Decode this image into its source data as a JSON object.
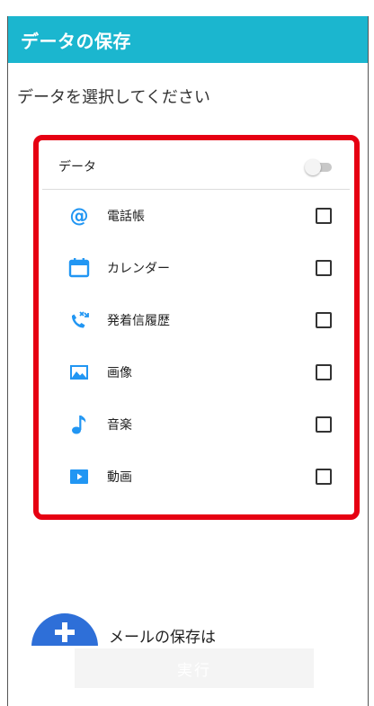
{
  "appbar": {
    "title": "データの保存"
  },
  "prompt": "データを選択してください",
  "card": {
    "header_label": "データ",
    "toggle_on": false,
    "items": [
      {
        "label": "電話帳",
        "icon": "at-sign-icon",
        "checked": false
      },
      {
        "label": "カレンダー",
        "icon": "calendar-icon",
        "checked": false
      },
      {
        "label": "発着信履歴",
        "icon": "call-log-icon",
        "checked": false
      },
      {
        "label": "画像",
        "icon": "image-icon",
        "checked": false
      },
      {
        "label": "音楽",
        "icon": "music-note-icon",
        "checked": false
      },
      {
        "label": "動画",
        "icon": "video-play-icon",
        "checked": false
      }
    ]
  },
  "fab": {
    "label": "メールの保存は"
  },
  "run_button": {
    "label": "実行"
  },
  "colors": {
    "accent": "#1bb6cf",
    "highlight": "#e60012",
    "fab": "#2e6fd8",
    "icon": "#2196f3"
  }
}
